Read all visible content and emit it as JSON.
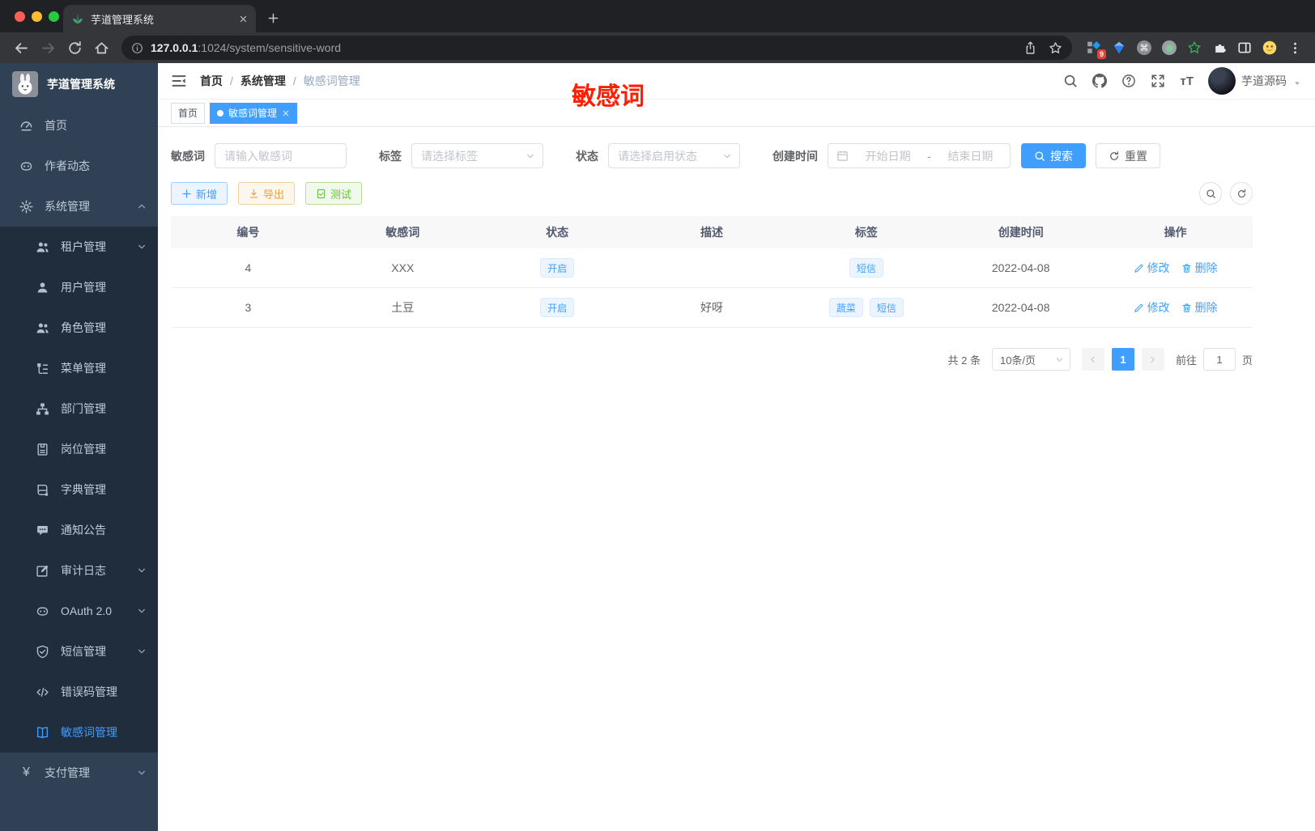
{
  "browser": {
    "tab_title": "芋道管理系统",
    "url_host": "127.0.0.1",
    "url_rest": ":1024/system/sensitive-word",
    "ext_badge": "9"
  },
  "icons": {
    "yen": "¥",
    "cmd": "⌘",
    "font_size": "тT"
  },
  "sidebar": {
    "logo_title": "芋道管理系统",
    "top": [
      {
        "label": "首页",
        "icon": "dashboard-icon"
      },
      {
        "label": "作者动态",
        "icon": "robot-icon"
      },
      {
        "label": "系统管理",
        "icon": "gear-icon"
      }
    ],
    "submenu": [
      {
        "label": "租户管理",
        "icon": "users-icon"
      },
      {
        "label": "用户管理",
        "icon": "user-icon"
      },
      {
        "label": "角色管理",
        "icon": "users-icon"
      },
      {
        "label": "菜单管理",
        "icon": "tree-icon"
      },
      {
        "label": "部门管理",
        "icon": "org-icon"
      },
      {
        "label": "岗位管理",
        "icon": "badge-icon"
      },
      {
        "label": "字典管理",
        "icon": "book-icon"
      },
      {
        "label": "通知公告",
        "icon": "bubble-icon"
      },
      {
        "label": "审计日志",
        "icon": "edit-icon"
      },
      {
        "label": "OAuth 2.0",
        "icon": "robot-icon"
      },
      {
        "label": "短信管理",
        "icon": "shield-icon"
      },
      {
        "label": "错误码管理",
        "icon": "code-icon"
      },
      {
        "label": "敏感词管理",
        "icon": "book-open-icon"
      }
    ],
    "bottom": [
      {
        "label": "支付管理",
        "icon": "yen-icon"
      }
    ]
  },
  "header": {
    "crumb1": "首页",
    "crumb2": "系统管理",
    "crumb3": "敏感词管理",
    "separator": "/",
    "watermark": "敏感词",
    "username": "芋道源码"
  },
  "tags": {
    "tab1": "首页",
    "tab2": "敏感词管理"
  },
  "filters": {
    "keyword_label": "敏感词",
    "keyword_placeholder": "请输入敏感词",
    "tag_label": "标签",
    "tag_placeholder": "请选择标签",
    "status_label": "状态",
    "status_placeholder": "请选择启用状态",
    "date_label": "创建时间",
    "date_start": "开始日期",
    "date_dash": "-",
    "date_end": "结束日期",
    "search": "搜索",
    "reset": "重置"
  },
  "toolbar": {
    "add": "新增",
    "export": "导出",
    "test": "测试"
  },
  "table": {
    "col_id": "编号",
    "col_word": "敏感词",
    "col_status": "状态",
    "col_desc": "描述",
    "col_tags": "标签",
    "col_created": "创建时间",
    "col_ops": "操作",
    "rows": [
      {
        "id": "4",
        "word": "XXX",
        "status": "开启",
        "desc": "",
        "tag1": "短信",
        "created": "2022-04-08",
        "edit": "修改",
        "del": "删除"
      },
      {
        "id": "3",
        "word": "土豆",
        "status": "开启",
        "desc": "好呀",
        "tag1": "蔬菜",
        "tag2": "短信",
        "created": "2022-04-08",
        "edit": "修改",
        "del": "删除"
      }
    ]
  },
  "pagination": {
    "total": "共 2 条",
    "size": "10条/页",
    "page": "1",
    "goto": "前往",
    "goto_value": "1",
    "unit": "页"
  },
  "colors": {
    "primary": "#409eff",
    "sidebar_bg": "#304156",
    "submenu_bg": "#1f2d3d",
    "tag_bg": "#ecf5ff",
    "warning": "#e6a23c",
    "success": "#67c23a",
    "watermark": "#ff1e00"
  }
}
